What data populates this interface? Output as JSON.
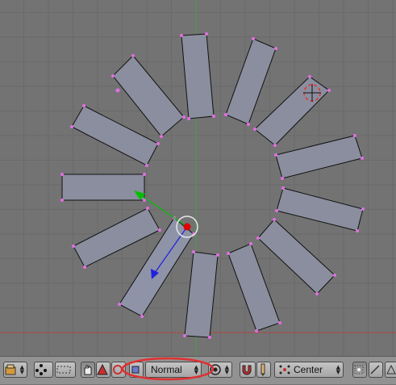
{
  "viewport": {
    "background": "#737373",
    "grid_color": "#6a6a6a",
    "face_fill": "#8a8e9e",
    "face_selected_fill": "#9aa0b4",
    "edge_color": "#111111",
    "vertex_color": "#e46ee4",
    "x_axis_color": "#b44b4b",
    "y_axis_color": "#4bb44b",
    "manipulator_x_color": "#3030d8",
    "manipulator_y_color": "#00c000",
    "manipulator_center_color": "#e00000"
  },
  "header": {
    "background": "#929292",
    "pivot_mode": {
      "selected": "Normal"
    },
    "pivot_center": {
      "selected": "Center"
    },
    "annotation_color": "#e03030",
    "icons": [
      "editor-type-icon",
      "view-menu-icon",
      "vertex-select-icon",
      "hand-translate-icon",
      "rotate-triangle-icon",
      "scale-circle-icon",
      "snap-square-icon",
      "proportional-circle-icon",
      "magnet-icon",
      "pencil-icon",
      "center-dots-icon",
      "vertex-mode-icon",
      "edge-mode-icon",
      "face-mode-icon"
    ]
  }
}
